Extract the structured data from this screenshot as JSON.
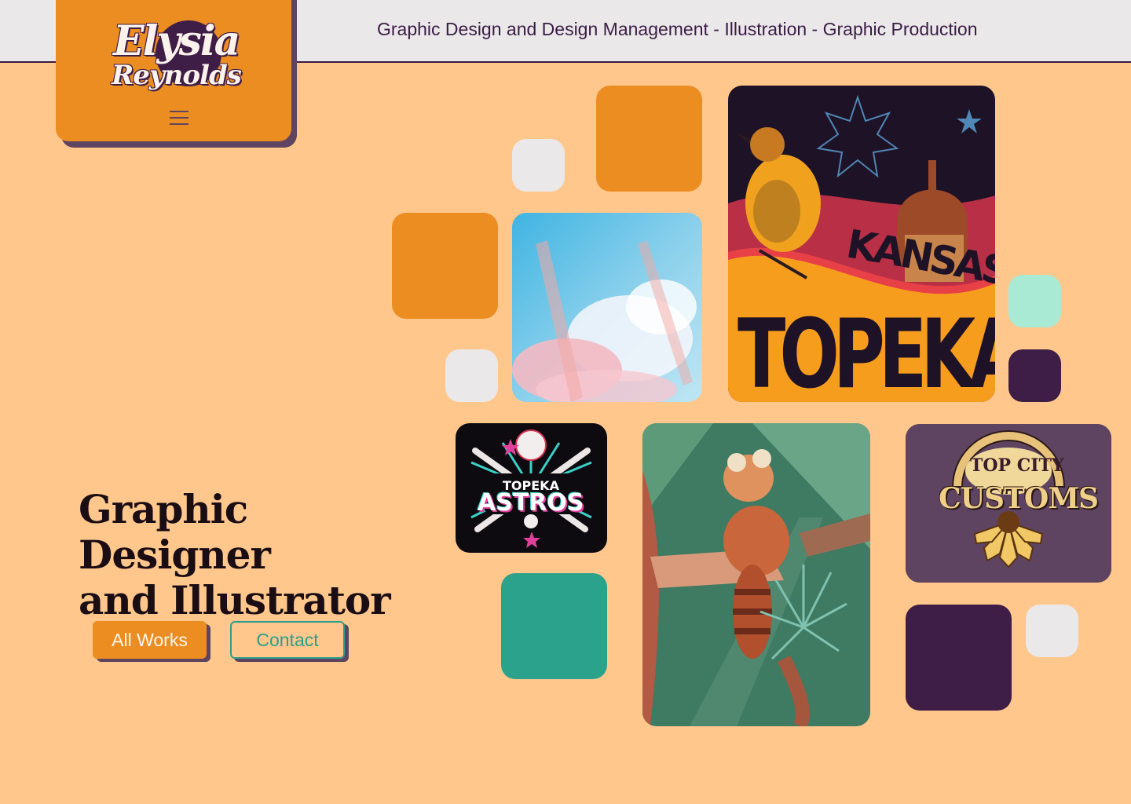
{
  "header": {
    "tagline": "Graphic Design and Design Management - Illustration - Graphic Production"
  },
  "logo": {
    "line1": "Elysia",
    "line2": "Reynolds",
    "menu_icon": "hamburger-menu-icon"
  },
  "hero": {
    "title_line1": "Graphic Designer",
    "title_line2": "and Illustrator"
  },
  "actions": {
    "all_works_label": "All Works",
    "contact_label": "Contact"
  },
  "gallery": {
    "topeka_poster": {
      "line1": "KANSAS",
      "line2": "TOPEKA"
    },
    "astros_logo": {
      "line1": "TOPEKA",
      "line2": "ASTROS"
    },
    "top_city_logo": {
      "line1": "TOP CITY",
      "line2": "CUSTOMS"
    }
  },
  "colors": {
    "background": "#ffc78c",
    "orange": "#ec8d22",
    "purple": "#3e1d46",
    "teal": "#2ba28c",
    "mint": "#a9ead4",
    "light_grey": "#ebe8ea",
    "mauve": "#5e4460"
  }
}
